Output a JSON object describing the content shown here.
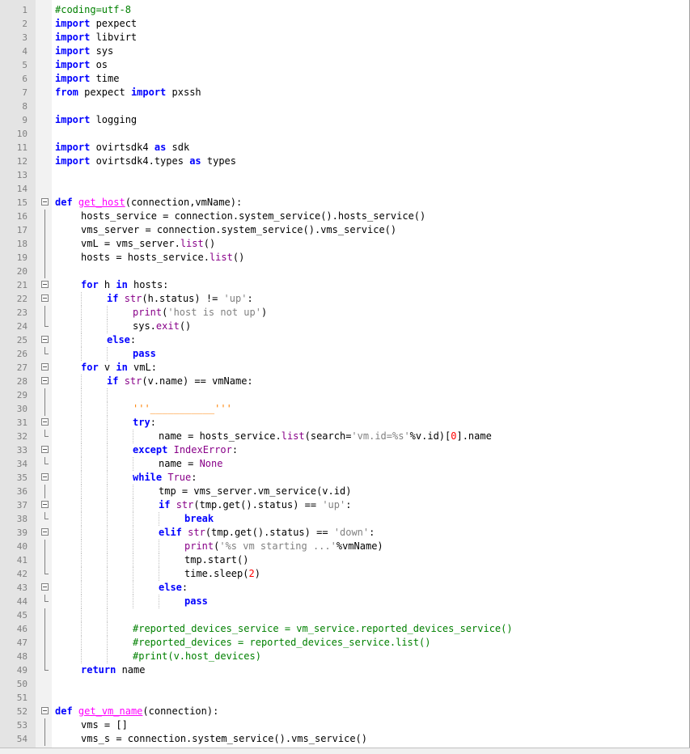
{
  "editor": {
    "lines": [
      {
        "n": "1",
        "indent": 0,
        "fold": "",
        "tokens": [
          [
            "cm",
            "#coding=utf-8"
          ]
        ]
      },
      {
        "n": "2",
        "indent": 0,
        "fold": "",
        "tokens": [
          [
            "kw",
            "import"
          ],
          [
            "",
            "pexpect"
          ]
        ]
      },
      {
        "n": "3",
        "indent": 0,
        "fold": "",
        "tokens": [
          [
            "kw",
            "import"
          ],
          [
            "",
            "libvirt"
          ]
        ]
      },
      {
        "n": "4",
        "indent": 0,
        "fold": "",
        "tokens": [
          [
            "kw",
            "import"
          ],
          [
            "",
            "sys"
          ]
        ]
      },
      {
        "n": "5",
        "indent": 0,
        "fold": "",
        "tokens": [
          [
            "kw",
            "import"
          ],
          [
            "",
            "os"
          ]
        ]
      },
      {
        "n": "6",
        "indent": 0,
        "fold": "",
        "tokens": [
          [
            "kw",
            "import"
          ],
          [
            "",
            "time"
          ]
        ]
      },
      {
        "n": "7",
        "indent": 0,
        "fold": "",
        "tokens": [
          [
            "kw",
            "from"
          ],
          [
            "",
            " pexpect "
          ],
          [
            "kw",
            "import"
          ],
          [
            "",
            "",
            " pxssh"
          ]
        ]
      },
      {
        "n": "8",
        "indent": 0,
        "fold": "",
        "tokens": []
      },
      {
        "n": "9",
        "indent": 0,
        "fold": "",
        "tokens": [
          [
            "kw",
            "import"
          ],
          [
            "",
            "logging"
          ]
        ]
      },
      {
        "n": "10",
        "indent": 0,
        "fold": "",
        "tokens": []
      },
      {
        "n": "11",
        "indent": 0,
        "fold": "",
        "tokens": [
          [
            "kw",
            "import"
          ],
          [
            "",
            " ovirtsdk4 "
          ],
          [
            "kw",
            "as"
          ],
          [
            "",
            " sdk"
          ]
        ]
      },
      {
        "n": "12",
        "indent": 0,
        "fold": "",
        "tokens": [
          [
            "kw",
            "import"
          ],
          [
            "",
            " ovirtsdk4.types "
          ],
          [
            "kw",
            "as"
          ],
          [
            "",
            " types"
          ]
        ]
      },
      {
        "n": "13",
        "indent": 0,
        "fold": "",
        "tokens": []
      },
      {
        "n": "14",
        "indent": 0,
        "fold": "",
        "tokens": []
      },
      {
        "n": "15",
        "indent": 0,
        "fold": "open",
        "tokens": [
          [
            "kw",
            "def"
          ],
          [
            "",
            " "
          ],
          [
            "fn",
            "get_host"
          ],
          [
            "",
            "(connection,vmName):"
          ]
        ]
      },
      {
        "n": "16",
        "indent": 1,
        "fold": "line",
        "tokens": [
          [
            "",
            "hosts_service = connection.system_service().hosts_service()"
          ]
        ]
      },
      {
        "n": "17",
        "indent": 1,
        "fold": "line",
        "tokens": [
          [
            "",
            "vms_server = connection.system_service().vms_service()"
          ]
        ]
      },
      {
        "n": "18",
        "indent": 1,
        "fold": "line",
        "tokens": [
          [
            "",
            "vmL = vms_server."
          ],
          [
            "bi",
            "list"
          ],
          [
            "",
            "()"
          ]
        ]
      },
      {
        "n": "19",
        "indent": 1,
        "fold": "line",
        "tokens": [
          [
            "",
            "hosts = hosts_service."
          ],
          [
            "bi",
            "list"
          ],
          [
            "",
            "()"
          ]
        ]
      },
      {
        "n": "20",
        "indent": 1,
        "fold": "line",
        "tokens": []
      },
      {
        "n": "21",
        "indent": 1,
        "fold": "open",
        "tokens": [
          [
            "kw",
            "for"
          ],
          [
            "",
            " h "
          ],
          [
            "kw",
            "in"
          ],
          [
            "",
            " hosts:"
          ]
        ]
      },
      {
        "n": "22",
        "indent": 2,
        "fold": "open",
        "tokens": [
          [
            "kw",
            "if"
          ],
          [
            "",
            " "
          ],
          [
            "bi",
            "str"
          ],
          [
            "",
            "(h.status) != "
          ],
          [
            "str",
            "'up'"
          ],
          [
            "",
            ":"
          ]
        ]
      },
      {
        "n": "23",
        "indent": 3,
        "fold": "line",
        "tokens": [
          [
            "bi",
            "print"
          ],
          [
            "",
            "("
          ],
          [
            "str",
            "'host is not up'"
          ],
          [
            "",
            ")"
          ]
        ]
      },
      {
        "n": "24",
        "indent": 3,
        "fold": "end",
        "tokens": [
          [
            "",
            "sys."
          ],
          [
            "bi",
            "exit"
          ],
          [
            "",
            "()"
          ]
        ]
      },
      {
        "n": "25",
        "indent": 2,
        "fold": "open",
        "tokens": [
          [
            "kw",
            "else"
          ],
          [
            "",
            ":"
          ]
        ]
      },
      {
        "n": "26",
        "indent": 3,
        "fold": "end",
        "tokens": [
          [
            "kw",
            "pass"
          ]
        ]
      },
      {
        "n": "27",
        "indent": 1,
        "fold": "open",
        "tokens": [
          [
            "kw",
            "for"
          ],
          [
            "",
            " v "
          ],
          [
            "kw",
            "in"
          ],
          [
            "",
            " vmL:"
          ]
        ]
      },
      {
        "n": "28",
        "indent": 2,
        "fold": "open",
        "tokens": [
          [
            "kw",
            "if"
          ],
          [
            "",
            " "
          ],
          [
            "bi",
            "str"
          ],
          [
            "",
            "(v.name) == vmName:"
          ]
        ]
      },
      {
        "n": "29",
        "indent": 3,
        "fold": "line",
        "tokens": []
      },
      {
        "n": "30",
        "indent": 3,
        "fold": "line",
        "tokens": [
          [
            "tq",
            "'''___________'''"
          ]
        ]
      },
      {
        "n": "31",
        "indent": 3,
        "fold": "open",
        "tokens": [
          [
            "kw",
            "try"
          ],
          [
            "",
            ":"
          ]
        ]
      },
      {
        "n": "32",
        "indent": 4,
        "fold": "end",
        "tokens": [
          [
            "",
            "name = hosts_service."
          ],
          [
            "bi",
            "list"
          ],
          [
            "",
            "(search="
          ],
          [
            "str",
            "'vm.id=%s'"
          ],
          [
            "",
            "%v.id)["
          ],
          [
            "num",
            "0"
          ],
          [
            "",
            "].name"
          ]
        ]
      },
      {
        "n": "33",
        "indent": 3,
        "fold": "open",
        "tokens": [
          [
            "kw",
            "except"
          ],
          [
            "",
            " "
          ],
          [
            "bi",
            "IndexError"
          ],
          [
            "",
            ":"
          ]
        ]
      },
      {
        "n": "34",
        "indent": 4,
        "fold": "end",
        "tokens": [
          [
            "",
            "name = "
          ],
          [
            "bi",
            "None"
          ]
        ]
      },
      {
        "n": "35",
        "indent": 3,
        "fold": "open",
        "tokens": [
          [
            "kw",
            "while"
          ],
          [
            "",
            " "
          ],
          [
            "bi",
            "True"
          ],
          [
            "",
            ":"
          ]
        ]
      },
      {
        "n": "36",
        "indent": 4,
        "fold": "line",
        "tokens": [
          [
            "",
            "tmp = vms_server.vm_service(v.id)"
          ]
        ]
      },
      {
        "n": "37",
        "indent": 4,
        "fold": "open",
        "tokens": [
          [
            "kw",
            "if"
          ],
          [
            "",
            " "
          ],
          [
            "bi",
            "str"
          ],
          [
            "",
            "(tmp.get().status) == "
          ],
          [
            "str",
            "'up'"
          ],
          [
            "",
            ":"
          ]
        ]
      },
      {
        "n": "38",
        "indent": 5,
        "fold": "end",
        "tokens": [
          [
            "kw",
            "break"
          ]
        ]
      },
      {
        "n": "39",
        "indent": 4,
        "fold": "open",
        "tokens": [
          [
            "kw",
            "elif"
          ],
          [
            "",
            " "
          ],
          [
            "bi",
            "str"
          ],
          [
            "",
            "(tmp.get().status) == "
          ],
          [
            "str",
            "'down'"
          ],
          [
            "",
            ":"
          ]
        ]
      },
      {
        "n": "40",
        "indent": 5,
        "fold": "line",
        "tokens": [
          [
            "bi",
            "print"
          ],
          [
            "",
            "("
          ],
          [
            "str",
            "'%s vm starting ...'"
          ],
          [
            "",
            "%vmName)"
          ]
        ]
      },
      {
        "n": "41",
        "indent": 5,
        "fold": "line",
        "tokens": [
          [
            "",
            "tmp.start()"
          ]
        ]
      },
      {
        "n": "42",
        "indent": 5,
        "fold": "end",
        "tokens": [
          [
            "",
            "time.sleep("
          ],
          [
            "num",
            "2"
          ],
          [
            "",
            ")"
          ]
        ]
      },
      {
        "n": "43",
        "indent": 4,
        "fold": "open",
        "tokens": [
          [
            "kw",
            "else"
          ],
          [
            "",
            ":"
          ]
        ]
      },
      {
        "n": "44",
        "indent": 5,
        "fold": "end",
        "tokens": [
          [
            "kw",
            "pass"
          ]
        ]
      },
      {
        "n": "45",
        "indent": 3,
        "fold": "line",
        "tokens": []
      },
      {
        "n": "46",
        "indent": 3,
        "fold": "line",
        "tokens": [
          [
            "cm",
            "#reported_devices_service = vm_service.reported_devices_service()"
          ]
        ]
      },
      {
        "n": "47",
        "indent": 3,
        "fold": "line",
        "tokens": [
          [
            "cm",
            "#reported_devices = reported_devices_service.list()"
          ]
        ]
      },
      {
        "n": "48",
        "indent": 3,
        "fold": "line",
        "tokens": [
          [
            "cm",
            "#print(v.host_devices)"
          ]
        ]
      },
      {
        "n": "49",
        "indent": 1,
        "fold": "end",
        "tokens": [
          [
            "kw",
            "return"
          ],
          [
            "",
            " name"
          ]
        ]
      },
      {
        "n": "50",
        "indent": 0,
        "fold": "",
        "tokens": []
      },
      {
        "n": "51",
        "indent": 0,
        "fold": "",
        "tokens": []
      },
      {
        "n": "52",
        "indent": 0,
        "fold": "open",
        "tokens": [
          [
            "kw",
            "def"
          ],
          [
            "",
            " "
          ],
          [
            "fn",
            "get_vm_name"
          ],
          [
            "",
            "(connection):"
          ]
        ]
      },
      {
        "n": "53",
        "indent": 1,
        "fold": "line",
        "tokens": [
          [
            "",
            "vms = []"
          ]
        ]
      },
      {
        "n": "54",
        "indent": 1,
        "fold": "line",
        "tokens": [
          [
            "",
            "vms_s = connection.system_service().vms_service()"
          ]
        ]
      }
    ]
  },
  "colors": {
    "keyword": "#0000ff",
    "builtin": "#880088",
    "function_name": "#ff00ff",
    "string": "#808080",
    "comment": "#008000",
    "number": "#ff0000",
    "triple_quote": "#ff8000"
  }
}
